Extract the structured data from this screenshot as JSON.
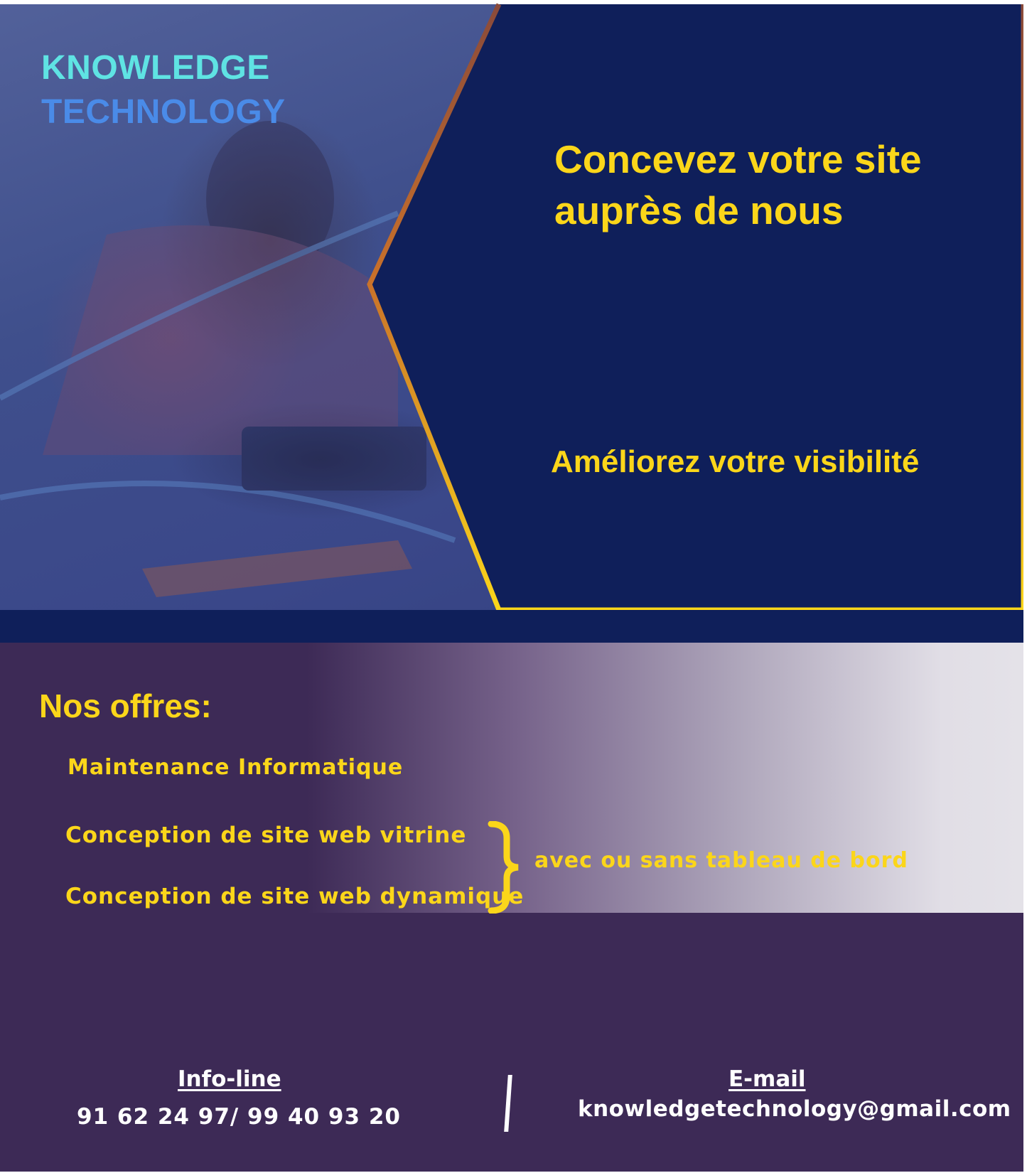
{
  "brand": {
    "line1": "KNOWLEDGE",
    "line2": "TECHNOLOGY"
  },
  "hero": {
    "headline": "Concevez votre site auprès de nous",
    "tagline": "Améliorez votre visibilité",
    "photo": "person-working-on-laptop-with-network-cables"
  },
  "offers": {
    "title": "Nos offres:",
    "items": [
      "Maintenance Informatique",
      "Conception de site web vitrine",
      "Conception de site web dynamique"
    ],
    "bracket_note": "avec ou sans tableau de bord"
  },
  "contact": {
    "phone_label": "Info-line",
    "phone_value": "91 62 24 97/ 99 40 93 20",
    "email_label": "E-mail",
    "email_value": "knowledgetechnology@gmail.com"
  },
  "colors": {
    "navy": "#0f1f5a",
    "yellow": "#fbd61a",
    "purple": "#3d2a56",
    "cyan": "#5fe3e3",
    "blue": "#4a8be8"
  }
}
